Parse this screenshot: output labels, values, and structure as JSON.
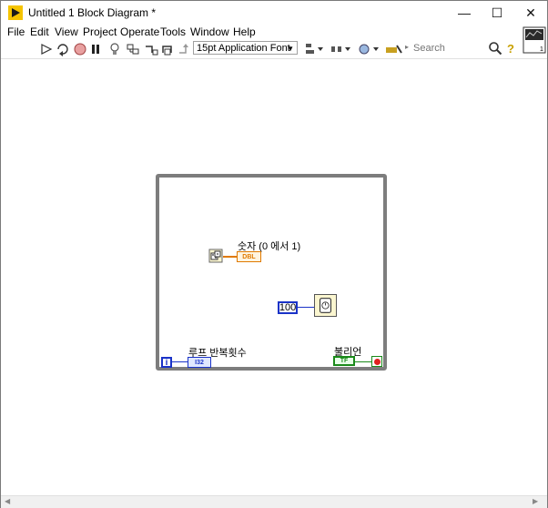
{
  "window": {
    "title": "Untitled 1 Block Diagram *",
    "minimize_glyph": "—",
    "maximize_glyph": "☐",
    "close_glyph": "✕"
  },
  "menu": {
    "items": [
      "File",
      "Edit",
      "View",
      "Project",
      "Operate",
      "Tools",
      "Window",
      "Help"
    ]
  },
  "toolbar": {
    "font_selector_value": "15pt Application Font",
    "search_placeholder": "Search",
    "help_glyph": "?"
  },
  "diagram": {
    "random_number_label": "숫자 (0 에서 1)",
    "dbl_indicator_text": "DBL",
    "wait_constant_value": "100",
    "iteration_label": "루프 반복횟수",
    "iteration_terminal_text": "i",
    "i32_indicator_text": "I32",
    "boolean_label": "불리언",
    "tf_control_text": "TF"
  },
  "colors": {
    "numeric_blue": "#1a33c8",
    "double_orange": "#e07a00",
    "boolean_green": "#1a8a1a",
    "loop_gray": "#7d7d7d",
    "stop_red": "#e02020"
  }
}
